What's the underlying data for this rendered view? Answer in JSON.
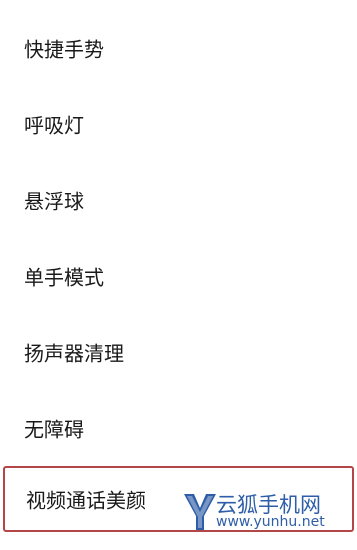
{
  "settings": {
    "items": [
      {
        "label": "快捷手势"
      },
      {
        "label": "呼吸灯"
      },
      {
        "label": "悬浮球"
      },
      {
        "label": "单手模式"
      },
      {
        "label": "扬声器清理"
      },
      {
        "label": "无障碍"
      },
      {
        "label": "视频通话美颜"
      }
    ]
  },
  "watermark": {
    "logo_icon": "yunhu-logo-icon",
    "title": "云狐手机网",
    "url": "www.yunhu.net",
    "color": "#2f5ea8"
  },
  "highlight_color": "#b34646"
}
